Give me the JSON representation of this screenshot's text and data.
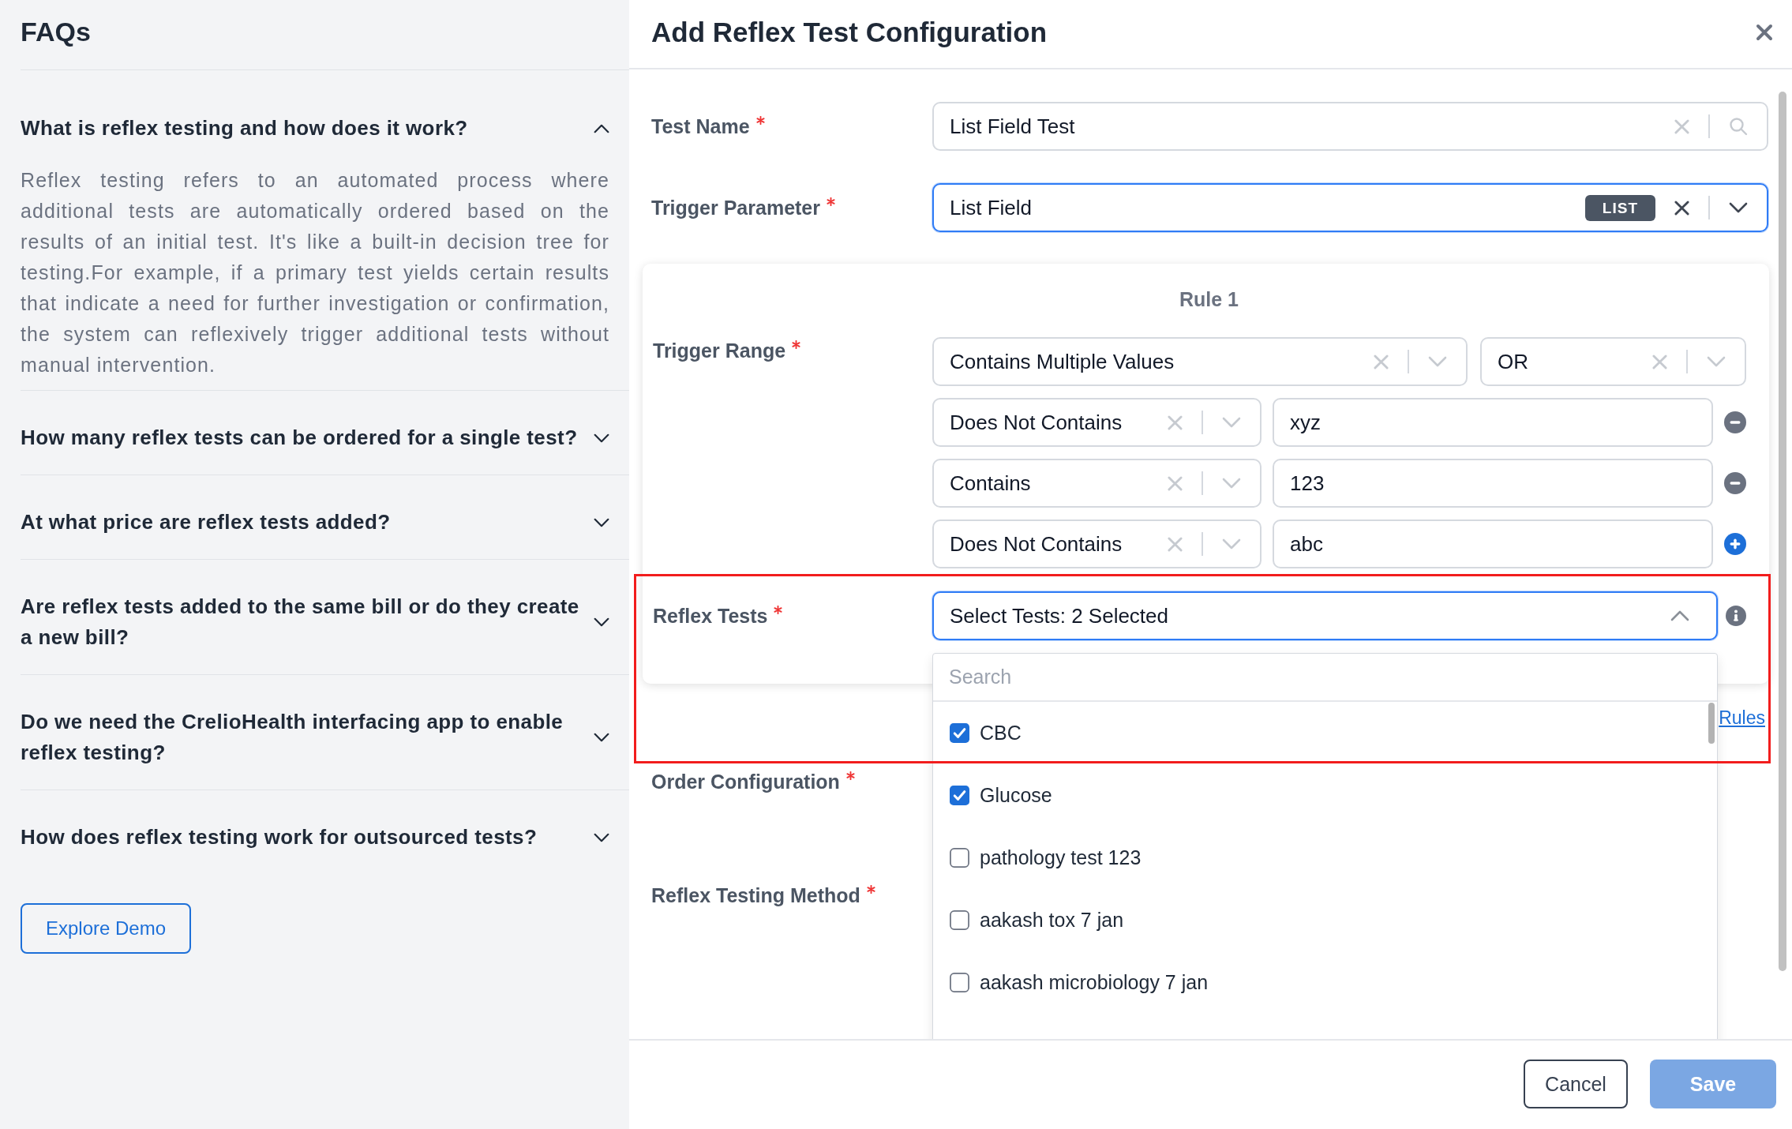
{
  "faq": {
    "title": "FAQs",
    "items": [
      {
        "question": "What is reflex testing and how does it work?",
        "expanded": true,
        "answer": "Reflex testing refers to an automated process where additional tests are automatically ordered based on the results of an initial test. It's like a built-in decision tree for testing.For example, if a primary test yields certain results that indicate a need for further investigation or confirmation, the system can reflexively trigger additional tests without manual intervention."
      },
      {
        "question": "How many reflex tests can be ordered for a single test?",
        "expanded": false
      },
      {
        "question": "At what price are reflex tests added?",
        "expanded": false
      },
      {
        "question": "Are reflex tests added to the same bill or do they create a new bill?",
        "expanded": false
      },
      {
        "question": "Do we need the CrelioHealth interfacing app to enable reflex testing?",
        "expanded": false
      },
      {
        "question": "How does reflex testing work for outsourced tests?",
        "expanded": false
      }
    ],
    "demo_button": "Explore Demo"
  },
  "modal": {
    "title": "Add Reflex Test Configuration",
    "fields": [
      {
        "label": "Test Name",
        "required": true,
        "kind": "search",
        "value": "List Field Test",
        "focused": false
      },
      {
        "label": "Trigger Parameter",
        "required": true,
        "kind": "select",
        "value": "List Field",
        "badge": "LIST",
        "focused": true
      }
    ],
    "rule": {
      "title": "Rule 1",
      "trigger_range": {
        "label": "Trigger Range",
        "required": true,
        "operator": "Contains Multiple Values",
        "join": "OR",
        "conditions": [
          {
            "operator": "Does Not Contains",
            "value": "xyz",
            "kind": "remove"
          },
          {
            "operator": "Contains",
            "value": "123",
            "kind": "remove"
          },
          {
            "operator": "Does Not Contains",
            "value": "abc",
            "kind": "add"
          }
        ]
      },
      "reflex_tests": {
        "label": "Reflex Tests",
        "required": true,
        "value": "Select Tests: 2 Selected",
        "focused": true,
        "expanded": true,
        "search_placeholder": "Search",
        "options": [
          {
            "label": "CBC",
            "checked": true
          },
          {
            "label": "Glucose",
            "checked": true
          },
          {
            "label": "pathology test 123",
            "checked": false
          },
          {
            "label": "aakash tox 7 jan",
            "checked": false
          },
          {
            "label": "aakash microbiology 7 jan",
            "checked": false
          }
        ]
      }
    },
    "rules_link": "Rules",
    "more_fields": [
      {
        "label": "Order Configuration",
        "required": true
      },
      {
        "label": "Reflex Testing Method",
        "required": true
      }
    ],
    "buttons": [
      {
        "label": "Cancel",
        "kind": "secondary",
        "disabled": false
      },
      {
        "label": "Save",
        "kind": "primary",
        "disabled": true
      }
    ]
  }
}
